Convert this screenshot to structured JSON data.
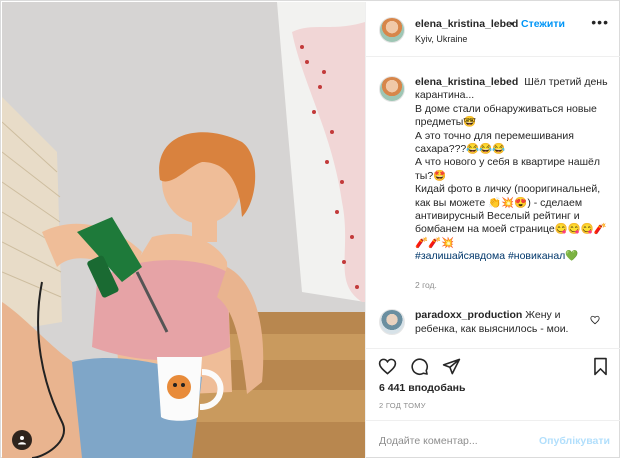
{
  "post": {
    "username": "elena_kristina_lebed",
    "dot": "•",
    "follow_label": "Стежити",
    "location": "Kyiv, Ukraine",
    "more_icon": "more-icon"
  },
  "caption": {
    "username": "elena_kristina_lebed",
    "lines": [
      "Шёл третий день карантина...",
      "В доме стали обнаруживаться новые предметы🤓",
      "А это точно для перемешивания сахара???😂😂😂",
      "А что нового у себя в квартире нашёл ты?🤩",
      "Кидай фото в личку (пооригинальней, как вы можете 👏💥😍) - сделаем антивирусный Веселый рейтинг и бомбанем на моей странице😋😋😋🧨🧨🧨💥"
    ],
    "hashtags": "#залишайсявдома #новиканал💚",
    "time": "2 год."
  },
  "comment": {
    "username": "paradoxx_production",
    "text": "Жену и ребенка, как выяснилось - мои."
  },
  "stats": {
    "likes": "6 441 вподобань",
    "time": "2 ГОД ТОМУ"
  },
  "add_comment": {
    "placeholder": "Додайте коментар...",
    "publish_label": "Опублікувати"
  },
  "colors": {
    "accent": "#0095f6",
    "hashtag": "#00376b",
    "muted": "#8e8e8e",
    "publish_disabled": "#b2dffc"
  }
}
